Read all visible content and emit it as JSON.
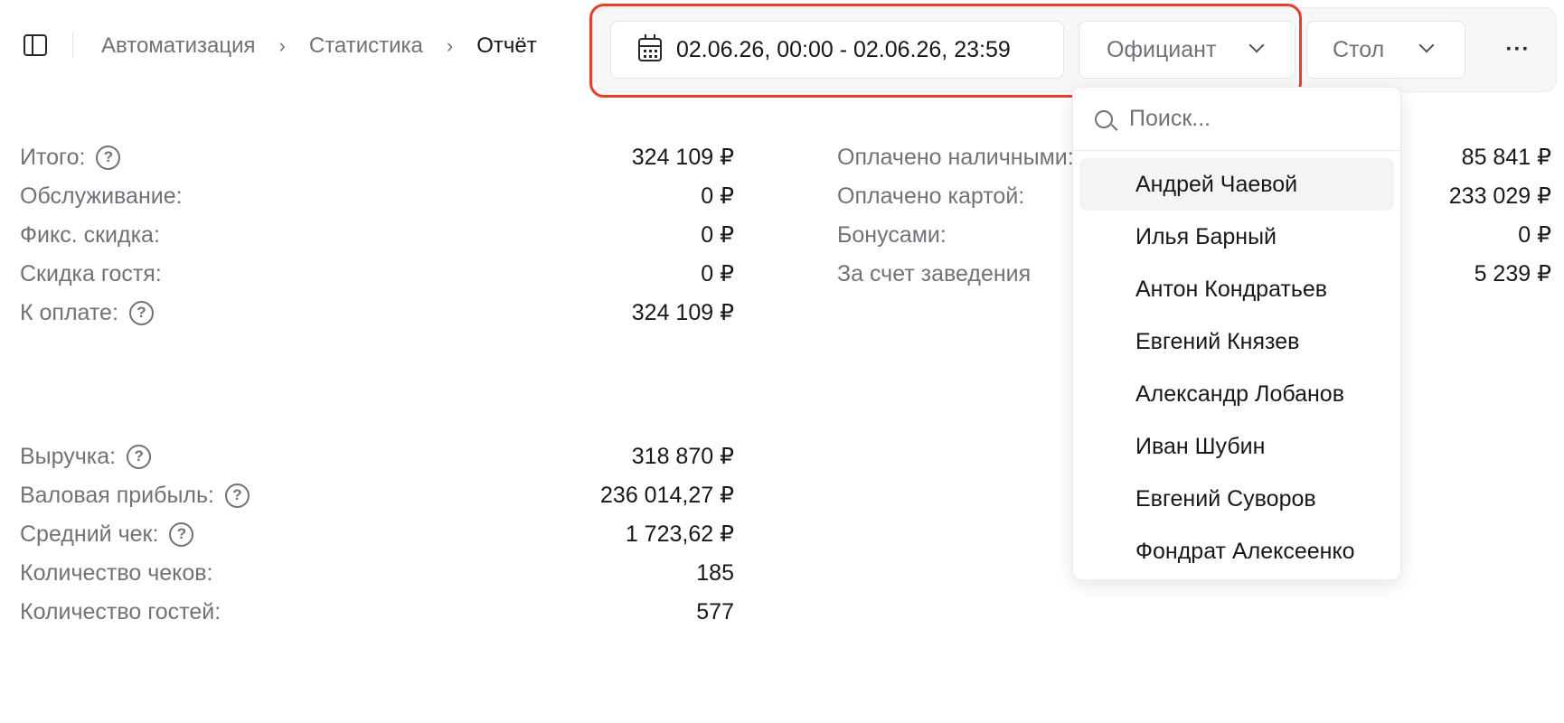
{
  "breadcrumb": [
    "Автоматизация",
    "Статистика",
    "Отчёт"
  ],
  "filters": {
    "date_range": "02.06.26, 00:00 - 02.06.26, 23:59",
    "waiter_placeholder": "Официант",
    "table_placeholder": "Стол",
    "more_label": "···"
  },
  "stats_left_top": [
    {
      "label": "Итого:",
      "value": "324 109 ₽",
      "help": true
    },
    {
      "label": "Обслуживание:",
      "value": "0 ₽",
      "help": false
    },
    {
      "label": "Фикс. скидка:",
      "value": "0 ₽",
      "help": false
    },
    {
      "label": "Скидка гостя:",
      "value": "0 ₽",
      "help": false
    },
    {
      "label": "К оплате:",
      "value": "324 109 ₽",
      "help": true
    }
  ],
  "stats_right_top": [
    {
      "label": "Оплачено наличными:",
      "value": "85 841 ₽"
    },
    {
      "label": "Оплачено картой:",
      "value": "233 029 ₽"
    },
    {
      "label": "Бонусами:",
      "value": "0 ₽"
    },
    {
      "label": "За счет заведения",
      "value": "5 239 ₽"
    }
  ],
  "stats_left_bottom": [
    {
      "label": "Выручка:",
      "value": "318 870 ₽",
      "help": true
    },
    {
      "label": "Валовая прибыль:",
      "value": "236 014,27 ₽",
      "help": true
    },
    {
      "label": "Средний чек:",
      "value": "1 723,62 ₽",
      "help": true
    },
    {
      "label": "Количество чеков:",
      "value": "185",
      "help": false
    },
    {
      "label": "Количество гостей:",
      "value": "577",
      "help": false
    }
  ],
  "help_glyph": "?",
  "dropdown": {
    "search_placeholder": "Поиск...",
    "items": [
      "Андрей Чаевой",
      "Илья Барный",
      "Антон Кондратьев",
      "Евгений Князев",
      "Александр Лобанов",
      "Иван Шубин",
      "Евгений Суворов",
      "Фондрат Алексеенко"
    ],
    "active_index": 0
  },
  "colors": {
    "highlight": "#ef3b2a",
    "muted_text": "#71717a",
    "primary_text": "#18181b"
  }
}
